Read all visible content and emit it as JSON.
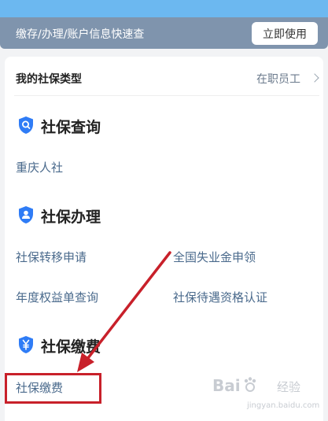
{
  "banner": {
    "text": "缴存/办理/账户信息快速查",
    "button_label": "立即使用"
  },
  "insurance_type": {
    "label": "我的社保类型",
    "value": "在职员工"
  },
  "sections": {
    "query": {
      "title": "社保查询",
      "icon": "search-shield-icon",
      "links": [
        "重庆人社"
      ]
    },
    "handle": {
      "title": "社保办理",
      "icon": "person-shield-icon",
      "links": [
        "社保转移申请",
        "全国失业金申领",
        "年度权益单查询",
        "社保待遇资格认证"
      ]
    },
    "payment": {
      "title": "社保缴费",
      "icon": "yuan-shield-icon",
      "links": [
        "社保缴费"
      ]
    }
  },
  "watermark": {
    "brand": "Bai",
    "brand_suffix": "经验",
    "url": "jingyan.baidu.com"
  },
  "colors": {
    "accent_blue": "#2f7cf6",
    "banner_bar": "#7f94ad",
    "link": "#4a6a8c",
    "annotation_red": "#c8202a"
  }
}
